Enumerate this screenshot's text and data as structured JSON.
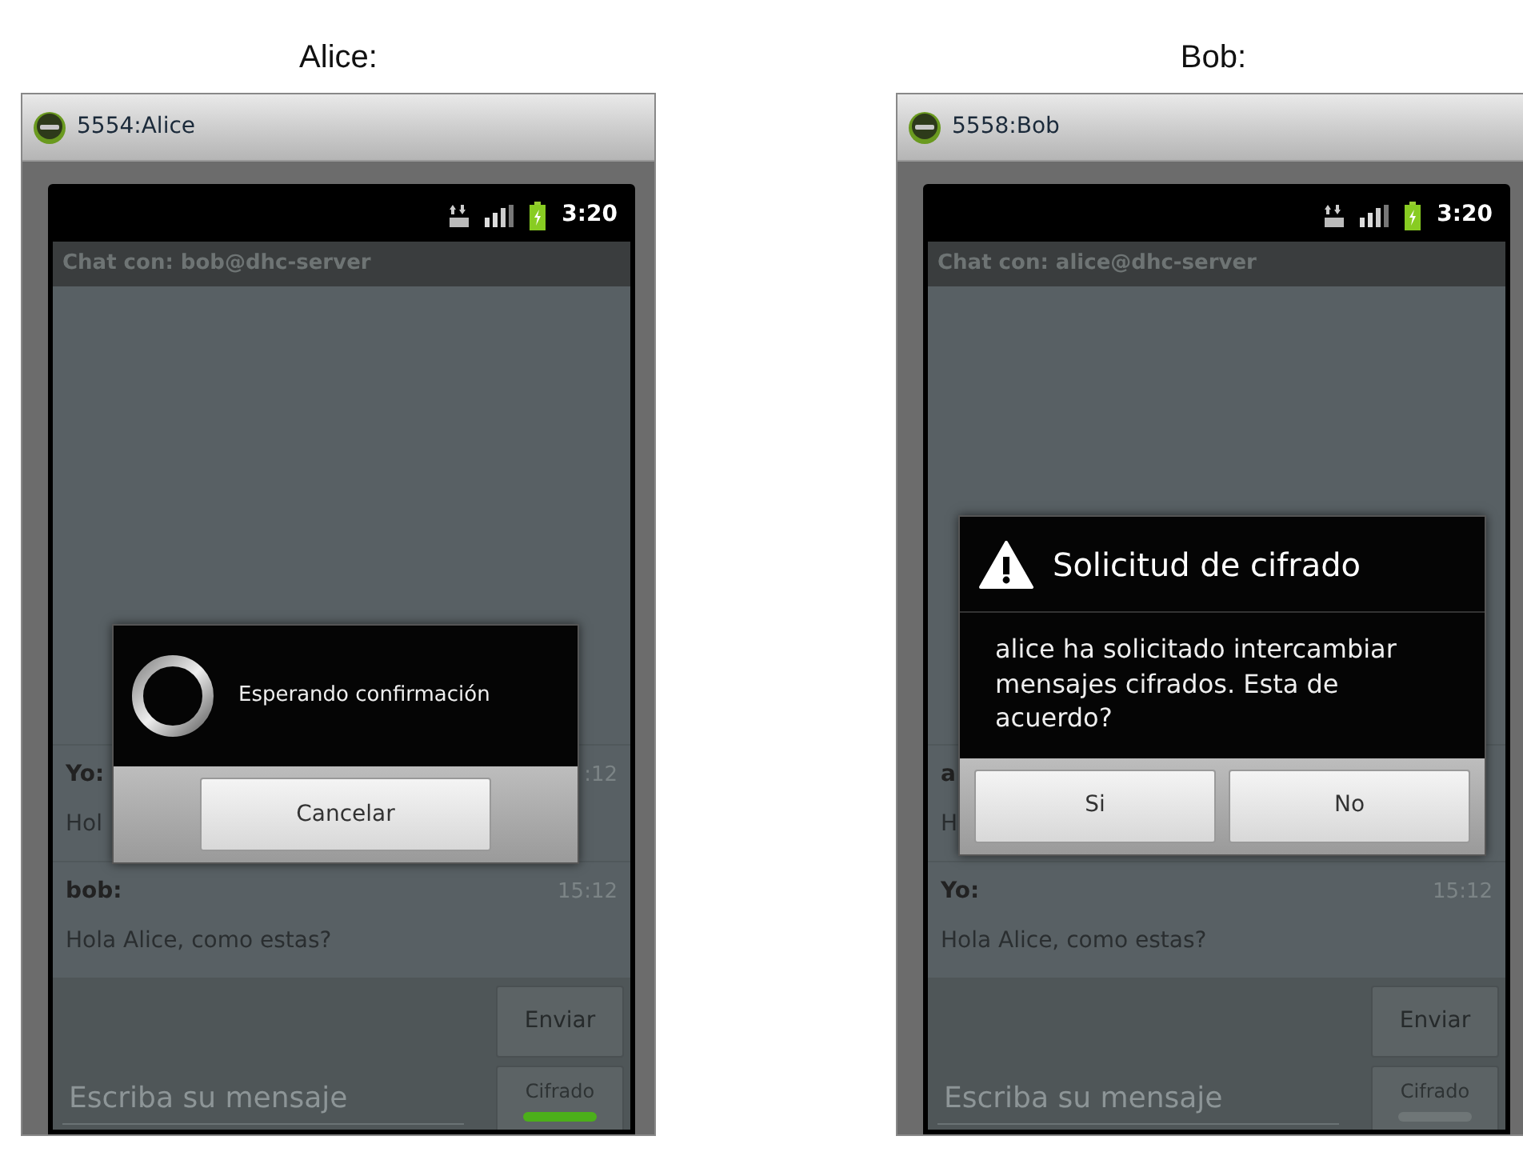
{
  "phones": [
    {
      "caption": "Alice:",
      "window_title": "5554:Alice",
      "status_time": "3:20",
      "chat_title": "Chat con: bob@dhc-server",
      "messages": [
        {
          "sender": "Yo:",
          "time": ":12",
          "text": "Hol"
        },
        {
          "sender": "bob:",
          "time": "15:12",
          "text": "Hola Alice, como estas?"
        }
      ],
      "dialog": {
        "kind": "progress",
        "message": "Esperando confirmación",
        "buttons": [
          "Cancelar"
        ]
      },
      "send_button": "Enviar",
      "input": {
        "placeholder": "Escriba su mensaje"
      },
      "encrypt_toggle": {
        "label": "Cifrado",
        "on": true
      }
    },
    {
      "caption": "Bob:",
      "window_title": "5558:Bob",
      "status_time": "3:20",
      "chat_title": "Chat con: alice@dhc-server",
      "messages": [
        {
          "sender": "a",
          "text": "H"
        },
        {
          "sender": "Yo:",
          "time": "15:12",
          "text": "Hola Alice, como estas?"
        }
      ],
      "dialog": {
        "kind": "alert",
        "title": "Solicitud de cifrado",
        "message": "alice ha solicitado intercambiar mensajes cifrados. Esta de acuerdo?",
        "buttons": [
          "Si",
          "No"
        ]
      },
      "send_button": "Enviar",
      "input": {
        "placeholder": "Escriba su mensaje"
      },
      "encrypt_toggle": {
        "label": "Cifrado",
        "on": false
      }
    }
  ]
}
